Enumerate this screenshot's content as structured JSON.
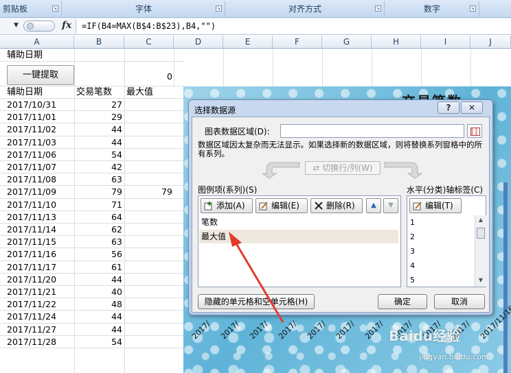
{
  "ribbon": {
    "groups": [
      "剪贴板",
      "字体",
      "对齐方式",
      "数字"
    ]
  },
  "formula_bar": {
    "fx": "fx",
    "formula": "=IF(B4=MAX(B$4:B$23),B4,\"\")"
  },
  "columns": [
    "A",
    "B",
    "C",
    "D",
    "E",
    "F",
    "G",
    "H",
    "I",
    "J"
  ],
  "sheet": {
    "a1": "辅助日期",
    "button_label": "一键提取",
    "c2": "0",
    "headers": [
      "辅助日期",
      "交易笔数",
      "最大值"
    ],
    "rows": [
      {
        "date": "2017/10/31",
        "count": "27",
        "max": ""
      },
      {
        "date": "2017/11/01",
        "count": "29",
        "max": ""
      },
      {
        "date": "2017/11/02",
        "count": "44",
        "max": ""
      },
      {
        "date": "2017/11/03",
        "count": "44",
        "max": ""
      },
      {
        "date": "2017/11/06",
        "count": "54",
        "max": ""
      },
      {
        "date": "2017/11/07",
        "count": "42",
        "max": ""
      },
      {
        "date": "2017/11/08",
        "count": "63",
        "max": ""
      },
      {
        "date": "2017/11/09",
        "count": "79",
        "max": "79"
      },
      {
        "date": "2017/11/10",
        "count": "71",
        "max": ""
      },
      {
        "date": "2017/11/13",
        "count": "64",
        "max": ""
      },
      {
        "date": "2017/11/14",
        "count": "62",
        "max": ""
      },
      {
        "date": "2017/11/15",
        "count": "63",
        "max": ""
      },
      {
        "date": "2017/11/16",
        "count": "56",
        "max": ""
      },
      {
        "date": "2017/11/17",
        "count": "61",
        "max": ""
      },
      {
        "date": "2017/11/20",
        "count": "44",
        "max": ""
      },
      {
        "date": "2017/11/21",
        "count": "40",
        "max": ""
      },
      {
        "date": "2017/11/22",
        "count": "48",
        "max": ""
      },
      {
        "date": "2017/11/24",
        "count": "44",
        "max": ""
      },
      {
        "date": "2017/11/27",
        "count": "44",
        "max": ""
      },
      {
        "date": "2017/11/28",
        "count": "54",
        "max": ""
      }
    ]
  },
  "chart": {
    "title": "交易笔数",
    "x_labels": [
      "2017/",
      "2017/",
      "2017/",
      "2017/",
      "2017/",
      "2017/",
      "2017/",
      "2017/",
      "2017/",
      "2017/",
      "2017/11/16"
    ]
  },
  "dialog": {
    "title": "选择数据源",
    "help": "?",
    "close": "✕",
    "range_label": "图表数据区域(D):",
    "range_value": "",
    "notice": "数据区域因太复杂而无法显示。如果选择新的数据区域，则将替换系列窗格中的所有系列。",
    "switch_label": "切换行/列(W)",
    "series_label": "图例项(系列)(S)",
    "add_label": "添加(A)",
    "edit_label": "编辑(E)",
    "delete_label": "删除(R)",
    "series": [
      "笔数",
      "最大值"
    ],
    "axis_label": "水平(分类)轴标签(C)",
    "axis_edit_label": "编辑(T)",
    "categories": [
      "1",
      "2",
      "3",
      "4",
      "5"
    ],
    "hidden_cells_label": "隐藏的单元格和空单元格(H)",
    "ok_label": "确定",
    "cancel_label": "取消"
  },
  "watermark": {
    "brand": "Baidu经验",
    "url": "jingyan.baidu.com"
  }
}
